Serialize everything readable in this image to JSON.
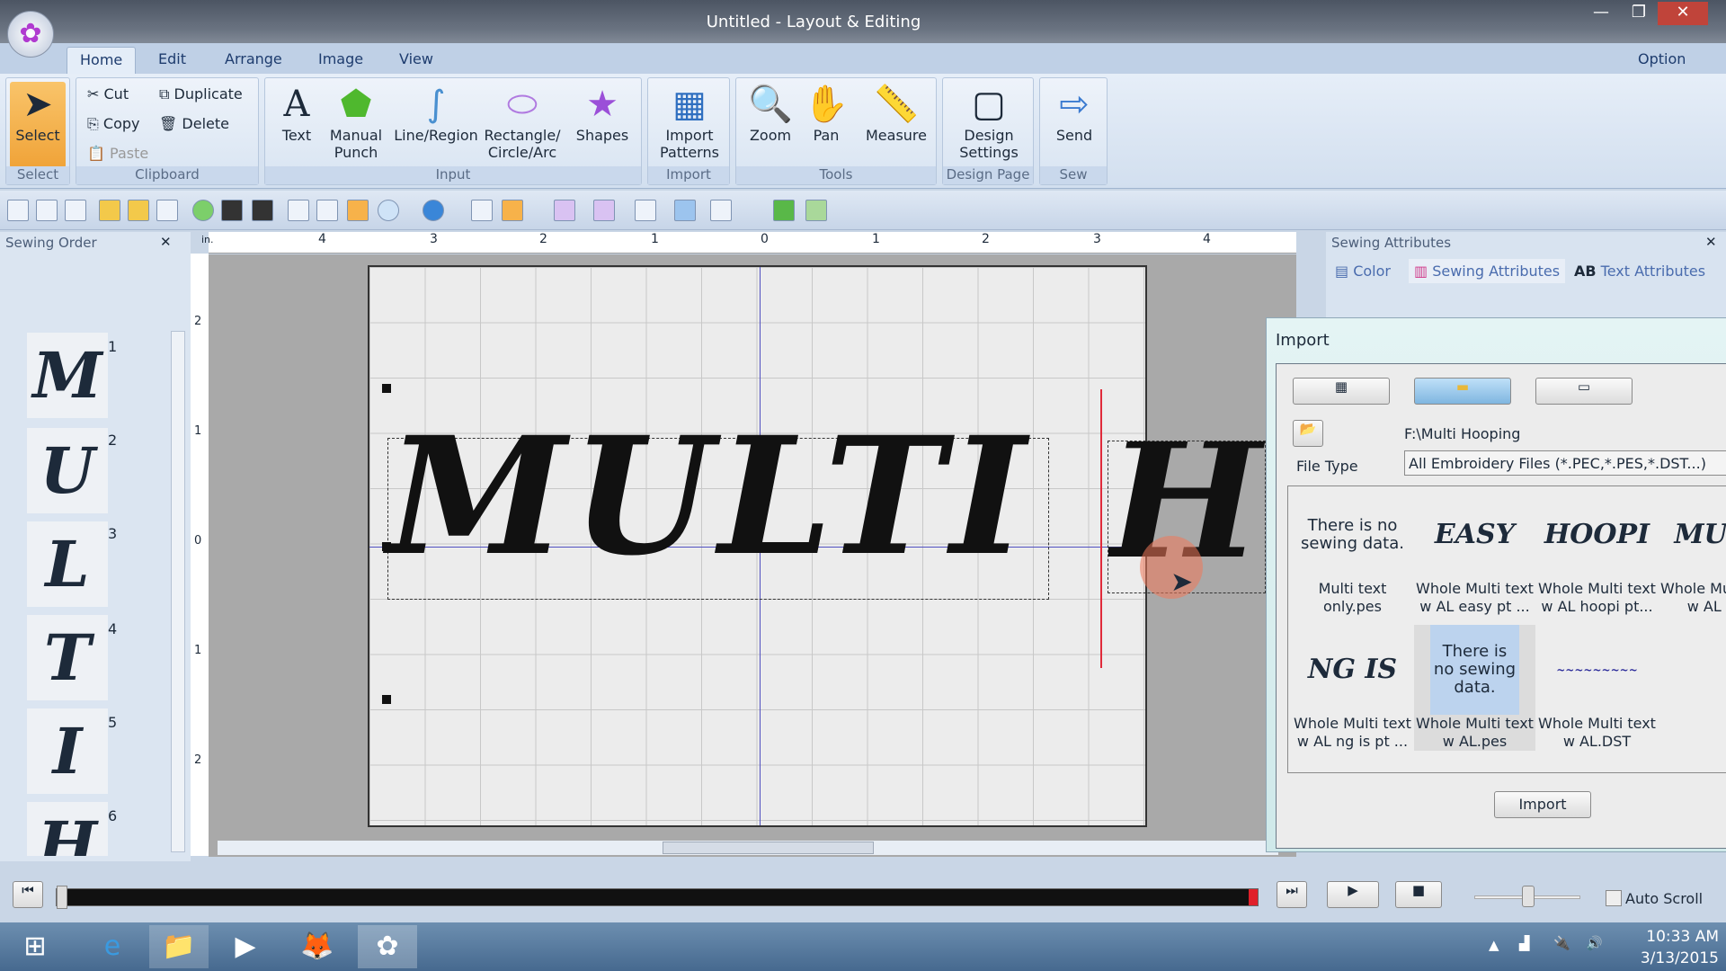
{
  "window": {
    "title": "Untitled - Layout & Editing",
    "minimize": "—",
    "maximize": "❐",
    "close": "✕"
  },
  "tabs": [
    {
      "label": "Home",
      "active": true
    },
    {
      "label": "Edit"
    },
    {
      "label": "Arrange"
    },
    {
      "label": "Image"
    },
    {
      "label": "View"
    }
  ],
  "option": "Option",
  "ribbon": {
    "select": {
      "label": "Select",
      "group": "Select"
    },
    "clipboard": {
      "group": "Clipboard",
      "cut": "Cut",
      "copy": "Copy",
      "paste": "Paste",
      "duplicate": "Duplicate",
      "delete": "Delete"
    },
    "input": {
      "group": "Input",
      "text": "Text",
      "manual": "Manual",
      "punch": "Punch",
      "line": "Line/Region",
      "rect": "Rectangle/",
      "circle": "Circle/Arc",
      "shapes": "Shapes"
    },
    "import": {
      "group": "Import",
      "l1": "Import",
      "l2": "Patterns"
    },
    "tools": {
      "group": "Tools",
      "zoom": "Zoom",
      "pan": "Pan",
      "measure": "Measure"
    },
    "design": {
      "group": "Design Page",
      "l1": "Design",
      "l2": "Settings"
    },
    "sew": {
      "group": "Sew",
      "send": "Send"
    }
  },
  "sewing_order": {
    "title": "Sewing Order",
    "items": [
      {
        "letter": "M",
        "n": "1"
      },
      {
        "letter": "U",
        "n": "2"
      },
      {
        "letter": "L",
        "n": "3"
      },
      {
        "letter": "T",
        "n": "4"
      },
      {
        "letter": "I",
        "n": "5"
      },
      {
        "letter": "H",
        "n": "6"
      }
    ]
  },
  "ruler": {
    "unit": "in.",
    "h": [
      "4",
      "3",
      "2",
      "1",
      "0",
      "1",
      "2",
      "3",
      "4"
    ],
    "v": [
      "2",
      "1",
      "0",
      "1",
      "2"
    ]
  },
  "canvas": {
    "text1": "MULTI",
    "text2": "H"
  },
  "attributes": {
    "title": "Sewing Attributes",
    "tabs": [
      "Color",
      "Sewing Attributes",
      "Text Attributes"
    ],
    "ab": "AB"
  },
  "import_dialog": {
    "title": "Import",
    "path": "F:\\Multi Hooping",
    "file_type_label": "File Type",
    "file_type": "All Embroidery Files (*.PEC,*.PES,*.DST...)",
    "files": [
      {
        "preview": "There is no sewing data.",
        "name": "Multi text only.pes"
      },
      {
        "preview": "EASY",
        "name": "Whole Multi text w AL easy pt ..."
      },
      {
        "preview": "HOOPI",
        "name": "Whole Multi text w AL hoopi pt..."
      },
      {
        "preview": "MULT",
        "name": "Whole Multi text w AL Mul"
      },
      {
        "preview": "NG IS",
        "name": "Whole Multi text w AL ng is  pt ..."
      },
      {
        "preview": "There is no sewing data.",
        "name": "Whole Multi text w AL.pes",
        "selected": true
      },
      {
        "preview": "~~~~~~~~~",
        "name": "Whole Multi text w AL.DST"
      }
    ],
    "import_button": "Import"
  },
  "playback": {
    "auto_scroll": "Auto Scroll",
    "progress": 100
  },
  "taskbar": {
    "time": "10:33 AM",
    "date": "3/13/2015"
  }
}
